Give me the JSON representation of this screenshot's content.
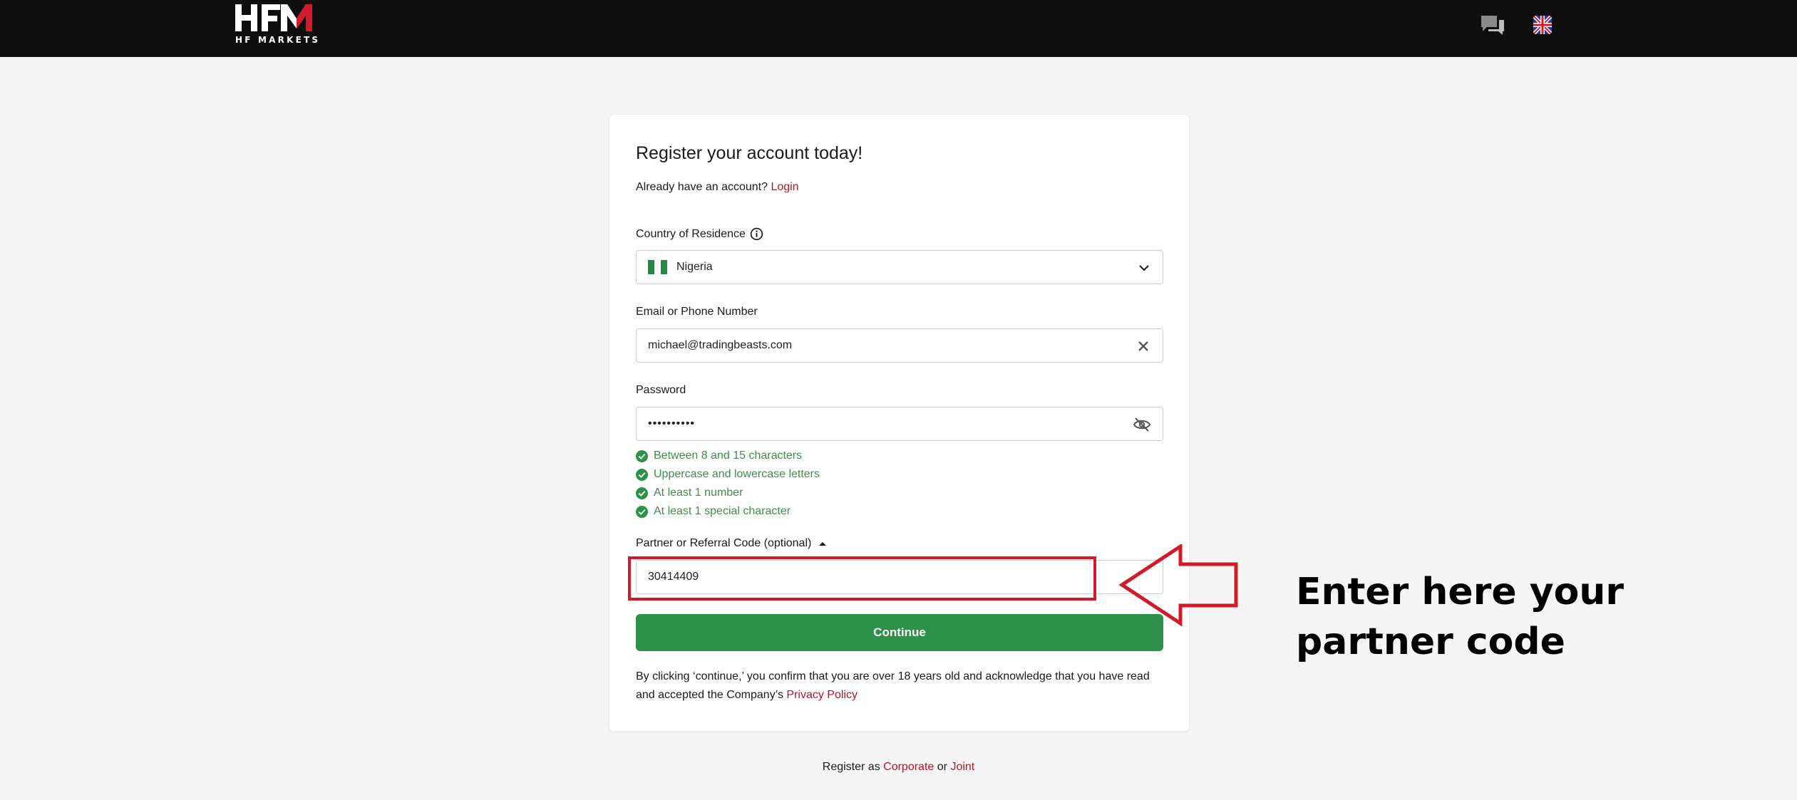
{
  "header": {
    "logo_sub": "HF MARKETS",
    "icons": [
      "chat-icon",
      "uk-flag-icon"
    ]
  },
  "form": {
    "title": "Register your account today!",
    "login_prompt": "Already have an account?",
    "login_link": "Login",
    "country": {
      "label": "Country of Residence",
      "value": "Nigeria"
    },
    "email": {
      "label": "Email or Phone Number",
      "value": "michael@tradingbeasts.com"
    },
    "password": {
      "label": "Password",
      "masked_value": "••••••••••"
    },
    "password_rules": [
      "Between 8 and 15 characters",
      "Uppercase and lowercase letters",
      "At least 1 number",
      "At least 1 special character"
    ],
    "partner": {
      "label": "Partner or Referral Code (optional)",
      "value": "30414409"
    },
    "continue_label": "Continue",
    "disclaimer_line1": "By clicking ‘continue,’ you confirm that you are over 18 years old and acknowledge that you have read",
    "disclaimer_line2": "and accepted the Company’s",
    "privacy_link": "Privacy Policy"
  },
  "footer": {
    "prefix": "Register as",
    "corporate": "Corporate",
    "or": "or",
    "joint": "Joint"
  },
  "annotation": {
    "line1": "Enter here your",
    "line2": "partner code"
  },
  "colors": {
    "brand_red": "#b4172b",
    "success_green": "#2e9149",
    "highlight_red": "#d21a2a"
  }
}
